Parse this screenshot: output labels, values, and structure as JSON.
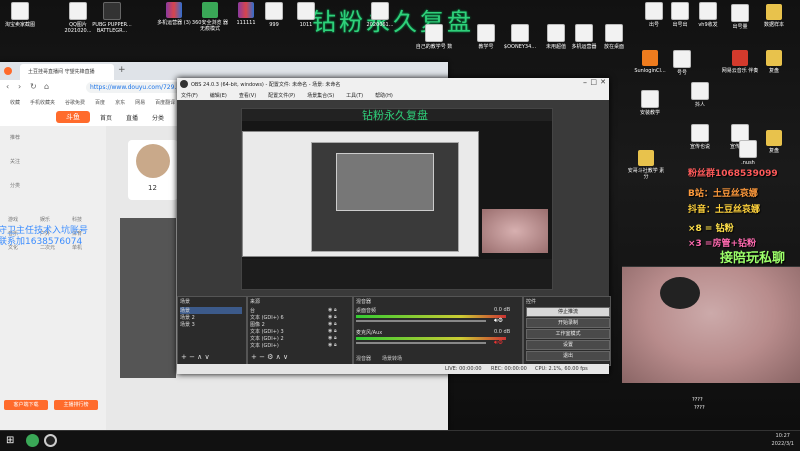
{
  "desktop": {
    "banner": "钻粉永久复盘",
    "icons": [
      {
        "label": "淘宝卖家截图",
        "cls": "doc"
      },
      {
        "label": "QQ图片 2021020...",
        "cls": "doc"
      },
      {
        "label": "PUBG PUPPER... BATTLEGR...",
        "cls": "app-dark"
      },
      {
        "label": "多机运营器 (3)",
        "cls": "app-rar"
      },
      {
        "label": "360安全浏览 器无痕模式",
        "cls": "app-green"
      },
      {
        "label": "111111",
        "cls": "app-rar"
      },
      {
        "label": "999",
        "cls": "doc"
      },
      {
        "label": "1011",
        "cls": "doc"
      },
      {
        "label": "2020061...",
        "cls": "doc"
      },
      {
        "label": "自己的教学号 数",
        "cls": "doc"
      },
      {
        "label": "教学号",
        "cls": "doc"
      },
      {
        "label": "$OONEY34...",
        "cls": "doc"
      },
      {
        "label": "未用超值",
        "cls": "doc"
      },
      {
        "label": "多机运营器",
        "cls": "doc"
      },
      {
        "label": "放在桌面",
        "cls": "doc"
      },
      {
        "label": "出号",
        "cls": "doc"
      },
      {
        "label": "出号出",
        "cls": "doc"
      },
      {
        "label": "vh9收发",
        "cls": "doc"
      },
      {
        "label": "出号量",
        "cls": "doc"
      },
      {
        "label": "数据样本",
        "cls": "fold"
      },
      {
        "label": "SunloginCl...",
        "cls": "app-orange"
      },
      {
        "label": "号号",
        "cls": "doc"
      },
      {
        "label": "网易云音乐 伴奏",
        "cls": "app-red"
      },
      {
        "label": "复盘",
        "cls": "fold"
      },
      {
        "label": "安装教学",
        "cls": "doc"
      },
      {
        "label": "抖人",
        "cls": "doc"
      },
      {
        "label": "宣传也说",
        "cls": "doc"
      },
      {
        "label": "宣传目标",
        "cls": "doc"
      },
      {
        "label": ".nush",
        "cls": "doc"
      },
      {
        "label": "复盘",
        "cls": "fold"
      },
      {
        "label": "安哥斗社教学 素分",
        "cls": "fold"
      }
    ]
  },
  "browser": {
    "tab_title": "土豆挂哥直播间 守望先锋直播",
    "url": "https://www.douyu.com/729...",
    "bookmarks": [
      "收藏",
      "手机收藏夹",
      "谷歌免费",
      "百度",
      "京东",
      "网易",
      "百度翻译"
    ],
    "logo": "斗鱼",
    "nav": [
      "首页",
      "直播",
      "分类"
    ],
    "overlay_lines": [
      "守卫主任技术入坑账号",
      "联系加1638576074"
    ],
    "sidebar_items": [
      "推荐",
      "关注",
      "分类",
      "游戏",
      "娱乐",
      "科技",
      "音乐",
      "户外",
      "体育",
      "文化",
      "二次元",
      "单机"
    ],
    "follow_count": "12",
    "bottom_buttons": [
      "客户端下载",
      "主播排行榜"
    ]
  },
  "obs": {
    "title": "OBS 24.0.3 (64-bit, windows) - 配置文件: 未命名 - 场景: 未命名",
    "menu": [
      "文件(F)",
      "编辑(E)",
      "查看(V)",
      "配置文件(P)",
      "场景集合(S)",
      "工具(T)",
      "帮助(H)"
    ],
    "preview_banner": "钻粉永久复盘",
    "docks": {
      "scenes": {
        "title": "场景",
        "items": [
          "场景",
          "场景 2",
          "场景 3"
        ]
      },
      "sources": {
        "title": "来源",
        "items": [
          "台",
          "文本 (GDI+) 6",
          "图像 2",
          "文本 (GDI+) 3",
          "文本 (GDI+) 2",
          "文本 (GDI+)"
        ]
      },
      "mixer": {
        "title": "混音器",
        "tracks": [
          {
            "name": "桌面音频",
            "db": "0.0 dB"
          },
          {
            "name": "麦克风/Aux",
            "db": "0.0 dB"
          }
        ]
      },
      "controls": {
        "title": "控件",
        "buttons": [
          "停止推流",
          "开始录制",
          "工作室模式",
          "设置",
          "退出"
        ]
      }
    },
    "tabs": [
      "混音器",
      "场景转场"
    ],
    "status": {
      "live": "LIVE: 00:00:00",
      "rec": "REC: 00:00:00",
      "cpu": "CPU: 2.1%, 60.00 fps"
    }
  },
  "overlay": {
    "lines": [
      {
        "text": "粉丝群1068539099",
        "color": "#ff5a5a"
      },
      {
        "text": "B站：土豆丝哀娜",
        "color": "#ff9a3c"
      },
      {
        "text": "抖音：土豆丝哀娜",
        "color": "#ffd23c"
      },
      {
        "text": "×8 = 钻粉",
        "color": "#ffe14a"
      },
      {
        "text": "×3 =房管+钻粉",
        "color": "#ff6ab0"
      }
    ],
    "big": "接陪玩私聊",
    "cam_caption": "????"
  },
  "taskbar": {
    "time": "10:27",
    "date": "2022/3/1"
  }
}
